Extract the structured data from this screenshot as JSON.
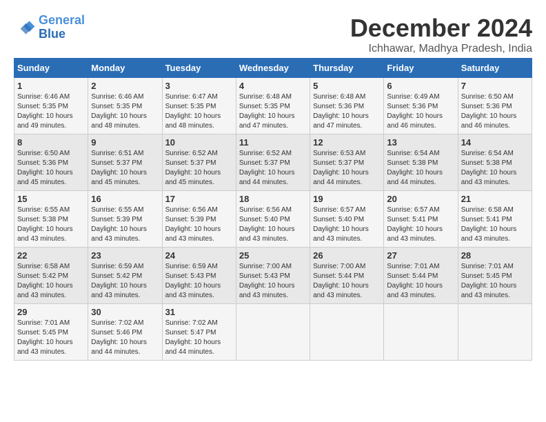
{
  "logo": {
    "line1": "General",
    "line2": "Blue"
  },
  "title": "December 2024",
  "subtitle": "Ichhawar, Madhya Pradesh, India",
  "weekdays": [
    "Sunday",
    "Monday",
    "Tuesday",
    "Wednesday",
    "Thursday",
    "Friday",
    "Saturday"
  ],
  "weeks": [
    [
      {
        "day": "1",
        "sunrise": "6:46 AM",
        "sunset": "5:35 PM",
        "daylight": "10 hours and 49 minutes."
      },
      {
        "day": "2",
        "sunrise": "6:46 AM",
        "sunset": "5:35 PM",
        "daylight": "10 hours and 48 minutes."
      },
      {
        "day": "3",
        "sunrise": "6:47 AM",
        "sunset": "5:35 PM",
        "daylight": "10 hours and 48 minutes."
      },
      {
        "day": "4",
        "sunrise": "6:48 AM",
        "sunset": "5:35 PM",
        "daylight": "10 hours and 47 minutes."
      },
      {
        "day": "5",
        "sunrise": "6:48 AM",
        "sunset": "5:36 PM",
        "daylight": "10 hours and 47 minutes."
      },
      {
        "day": "6",
        "sunrise": "6:49 AM",
        "sunset": "5:36 PM",
        "daylight": "10 hours and 46 minutes."
      },
      {
        "day": "7",
        "sunrise": "6:50 AM",
        "sunset": "5:36 PM",
        "daylight": "10 hours and 46 minutes."
      }
    ],
    [
      {
        "day": "8",
        "sunrise": "6:50 AM",
        "sunset": "5:36 PM",
        "daylight": "10 hours and 45 minutes."
      },
      {
        "day": "9",
        "sunrise": "6:51 AM",
        "sunset": "5:37 PM",
        "daylight": "10 hours and 45 minutes."
      },
      {
        "day": "10",
        "sunrise": "6:52 AM",
        "sunset": "5:37 PM",
        "daylight": "10 hours and 45 minutes."
      },
      {
        "day": "11",
        "sunrise": "6:52 AM",
        "sunset": "5:37 PM",
        "daylight": "10 hours and 44 minutes."
      },
      {
        "day": "12",
        "sunrise": "6:53 AM",
        "sunset": "5:37 PM",
        "daylight": "10 hours and 44 minutes."
      },
      {
        "day": "13",
        "sunrise": "6:54 AM",
        "sunset": "5:38 PM",
        "daylight": "10 hours and 44 minutes."
      },
      {
        "day": "14",
        "sunrise": "6:54 AM",
        "sunset": "5:38 PM",
        "daylight": "10 hours and 43 minutes."
      }
    ],
    [
      {
        "day": "15",
        "sunrise": "6:55 AM",
        "sunset": "5:38 PM",
        "daylight": "10 hours and 43 minutes."
      },
      {
        "day": "16",
        "sunrise": "6:55 AM",
        "sunset": "5:39 PM",
        "daylight": "10 hours and 43 minutes."
      },
      {
        "day": "17",
        "sunrise": "6:56 AM",
        "sunset": "5:39 PM",
        "daylight": "10 hours and 43 minutes."
      },
      {
        "day": "18",
        "sunrise": "6:56 AM",
        "sunset": "5:40 PM",
        "daylight": "10 hours and 43 minutes."
      },
      {
        "day": "19",
        "sunrise": "6:57 AM",
        "sunset": "5:40 PM",
        "daylight": "10 hours and 43 minutes."
      },
      {
        "day": "20",
        "sunrise": "6:57 AM",
        "sunset": "5:41 PM",
        "daylight": "10 hours and 43 minutes."
      },
      {
        "day": "21",
        "sunrise": "6:58 AM",
        "sunset": "5:41 PM",
        "daylight": "10 hours and 43 minutes."
      }
    ],
    [
      {
        "day": "22",
        "sunrise": "6:58 AM",
        "sunset": "5:42 PM",
        "daylight": "10 hours and 43 minutes."
      },
      {
        "day": "23",
        "sunrise": "6:59 AM",
        "sunset": "5:42 PM",
        "daylight": "10 hours and 43 minutes."
      },
      {
        "day": "24",
        "sunrise": "6:59 AM",
        "sunset": "5:43 PM",
        "daylight": "10 hours and 43 minutes."
      },
      {
        "day": "25",
        "sunrise": "7:00 AM",
        "sunset": "5:43 PM",
        "daylight": "10 hours and 43 minutes."
      },
      {
        "day": "26",
        "sunrise": "7:00 AM",
        "sunset": "5:44 PM",
        "daylight": "10 hours and 43 minutes."
      },
      {
        "day": "27",
        "sunrise": "7:01 AM",
        "sunset": "5:44 PM",
        "daylight": "10 hours and 43 minutes."
      },
      {
        "day": "28",
        "sunrise": "7:01 AM",
        "sunset": "5:45 PM",
        "daylight": "10 hours and 43 minutes."
      }
    ],
    [
      {
        "day": "29",
        "sunrise": "7:01 AM",
        "sunset": "5:45 PM",
        "daylight": "10 hours and 43 minutes."
      },
      {
        "day": "30",
        "sunrise": "7:02 AM",
        "sunset": "5:46 PM",
        "daylight": "10 hours and 44 minutes."
      },
      {
        "day": "31",
        "sunrise": "7:02 AM",
        "sunset": "5:47 PM",
        "daylight": "10 hours and 44 minutes."
      },
      null,
      null,
      null,
      null
    ]
  ],
  "labels": {
    "sunrise": "Sunrise: ",
    "sunset": "Sunset: ",
    "daylight": "Daylight: "
  }
}
